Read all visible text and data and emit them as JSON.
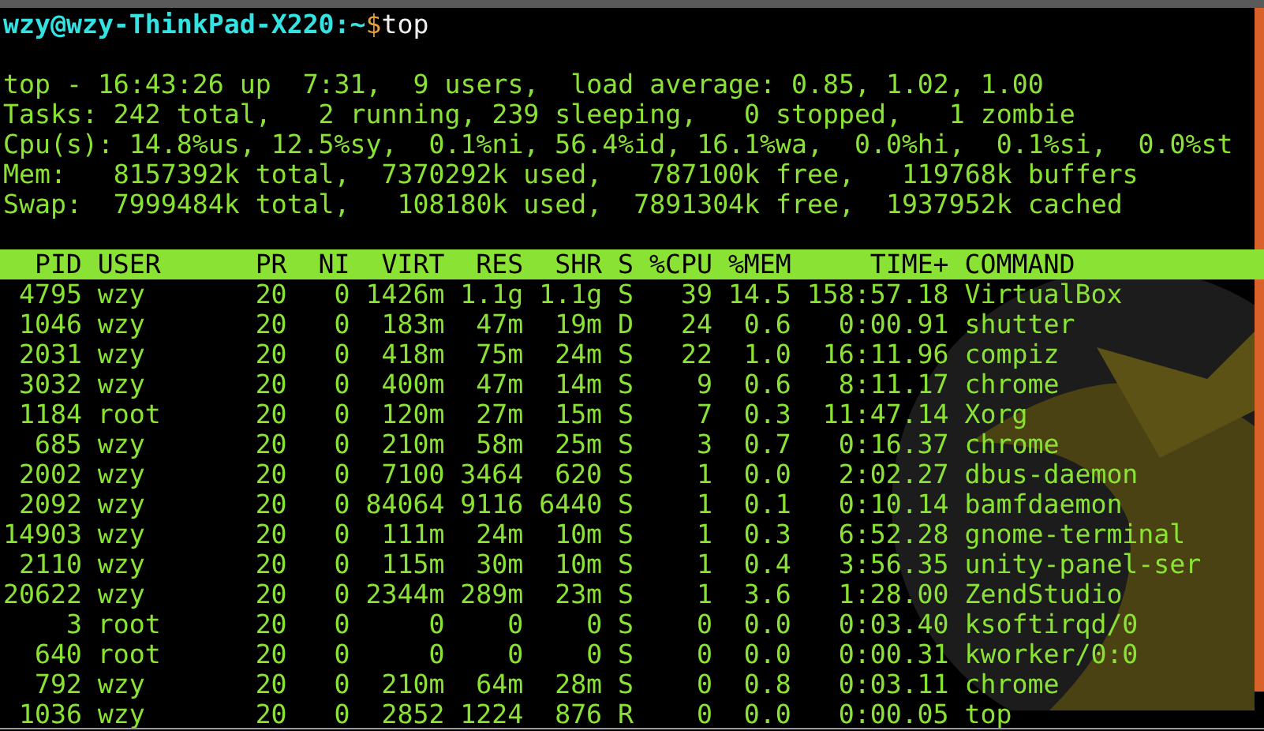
{
  "prompt": {
    "location": "wzy@wzy-ThinkPad-X220:~",
    "symbol": "$",
    "command": "top"
  },
  "summary": [
    "top - 16:43:26 up  7:31,  9 users,  load average: 0.85, 1.02, 1.00",
    "Tasks: 242 total,   2 running, 239 sleeping,   0 stopped,   1 zombie",
    "Cpu(s): 14.8%us, 12.5%sy,  0.1%ni, 56.4%id, 16.1%wa,  0.0%hi,  0.1%si,  0.0%st",
    "Mem:   8157392k total,  7370292k used,   787100k free,   119768k buffers",
    "Swap:  7999484k total,   108180k used,  7891304k free,  1937952k cached"
  ],
  "table": {
    "columns": [
      "PID",
      "USER",
      "PR",
      "NI",
      "VIRT",
      "RES",
      "SHR",
      "S",
      "%CPU",
      "%MEM",
      "TIME+",
      "COMMAND"
    ],
    "rows": [
      [
        "4795",
        "wzy",
        "20",
        "0",
        "1426m",
        "1.1g",
        "1.1g",
        "S",
        "39",
        "14.5",
        "158:57.18",
        "VirtualBox"
      ],
      [
        "1046",
        "wzy",
        "20",
        "0",
        "183m",
        "47m",
        "19m",
        "D",
        "24",
        "0.6",
        "0:00.91",
        "shutter"
      ],
      [
        "2031",
        "wzy",
        "20",
        "0",
        "418m",
        "75m",
        "24m",
        "S",
        "22",
        "1.0",
        "16:11.96",
        "compiz"
      ],
      [
        "3032",
        "wzy",
        "20",
        "0",
        "400m",
        "47m",
        "14m",
        "S",
        "9",
        "0.6",
        "8:11.17",
        "chrome"
      ],
      [
        "1184",
        "root",
        "20",
        "0",
        "120m",
        "27m",
        "15m",
        "S",
        "7",
        "0.3",
        "11:47.14",
        "Xorg"
      ],
      [
        "685",
        "wzy",
        "20",
        "0",
        "210m",
        "58m",
        "25m",
        "S",
        "3",
        "0.7",
        "0:16.37",
        "chrome"
      ],
      [
        "2002",
        "wzy",
        "20",
        "0",
        "7100",
        "3464",
        "620",
        "S",
        "1",
        "0.0",
        "2:02.27",
        "dbus-daemon"
      ],
      [
        "2092",
        "wzy",
        "20",
        "0",
        "84064",
        "9116",
        "6440",
        "S",
        "1",
        "0.1",
        "0:10.14",
        "bamfdaemon"
      ],
      [
        "14903",
        "wzy",
        "20",
        "0",
        "111m",
        "24m",
        "10m",
        "S",
        "1",
        "0.3",
        "6:52.28",
        "gnome-terminal"
      ],
      [
        "2110",
        "wzy",
        "20",
        "0",
        "115m",
        "30m",
        "10m",
        "S",
        "1",
        "0.4",
        "3:56.35",
        "unity-panel-ser"
      ],
      [
        "20622",
        "wzy",
        "20",
        "0",
        "2344m",
        "289m",
        "23m",
        "S",
        "1",
        "3.6",
        "1:28.00",
        "ZendStudio"
      ],
      [
        "3",
        "root",
        "20",
        "0",
        "0",
        "0",
        "0",
        "S",
        "0",
        "0.0",
        "0:03.40",
        "ksoftirqd/0"
      ],
      [
        "640",
        "root",
        "20",
        "0",
        "0",
        "0",
        "0",
        "S",
        "0",
        "0.0",
        "0:00.31",
        "kworker/0:0"
      ],
      [
        "792",
        "wzy",
        "20",
        "0",
        "210m",
        "64m",
        "28m",
        "S",
        "0",
        "0.8",
        "0:03.11",
        "chrome"
      ],
      [
        "1036",
        "wzy",
        "20",
        "0",
        "2852",
        "1224",
        "876",
        "R",
        "0",
        "0.0",
        "0:00.05",
        "top"
      ]
    ]
  }
}
